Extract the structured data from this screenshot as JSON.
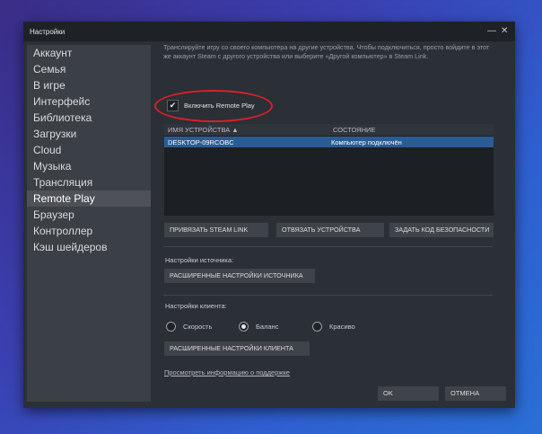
{
  "window": {
    "title": "Настройки",
    "minimize_glyph": "—",
    "close_glyph": "✕"
  },
  "sidebar": {
    "items": [
      {
        "label": "Аккаунт"
      },
      {
        "label": "Семья"
      },
      {
        "label": "В игре"
      },
      {
        "label": "Интерфейс"
      },
      {
        "label": "Библиотека"
      },
      {
        "label": "Загрузки"
      },
      {
        "label": "Cloud"
      },
      {
        "label": "Музыка"
      },
      {
        "label": "Трансляция"
      },
      {
        "label": "Remote Play"
      },
      {
        "label": "Браузер"
      },
      {
        "label": "Контроллер"
      },
      {
        "label": "Кэш шейдеров"
      }
    ],
    "active": "Remote Play"
  },
  "remote_play": {
    "description": "Транслируйте игру со своего компьютера на другие устройства. Чтобы подключиться, просто войдите в этот же аккаунт Steam с другого устройства или выберите «Другой компьютер» в Steam Link.",
    "enable_checkbox": {
      "label": "Включить Remote Play",
      "checked": true,
      "check_glyph": "✔"
    },
    "device_table": {
      "columns": [
        {
          "label": "ИМЯ УСТРОЙСТВА ▲"
        },
        {
          "label": "СОСТОЯНИЕ"
        }
      ],
      "rows": [
        {
          "name": "DESKTOP-09RCOBC",
          "status": "Компьютер подключён",
          "selected": true
        }
      ]
    },
    "buttons": {
      "pair_steam_link": "ПРИВЯЗАТЬ STEAM LINK",
      "unpair_devices": "ОТВЯЗАТЬ УСТРОЙСТВА",
      "set_security_code": "ЗАДАТЬ КОД БЕЗОПАСНОСТИ"
    },
    "host_settings": {
      "label": "Настройки источника:",
      "advanced_button": "РАСШИРЕННЫЕ НАСТРОЙКИ ИСТОЧНИКА"
    },
    "client_settings": {
      "label": "Настройки клиента:",
      "options": [
        {
          "label": "Скорость",
          "checked": false
        },
        {
          "label": "Баланс",
          "checked": true
        },
        {
          "label": "Красиво",
          "checked": false
        }
      ],
      "advanced_button": "РАСШИРЕННЫЕ НАСТРОЙКИ КЛИЕНТА"
    },
    "support_link": "Просмотреть информацию о поддержке"
  },
  "footer": {
    "ok_label": "OK",
    "cancel_label": "ОТМЕНА"
  },
  "colors": {
    "accent_selected_row": "#2a5c94",
    "annotation_ellipse": "#d8202a",
    "window_bg": "#2b2f36"
  }
}
